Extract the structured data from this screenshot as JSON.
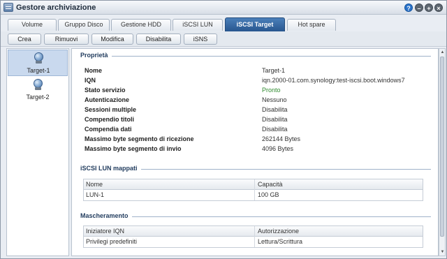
{
  "window": {
    "title": "Gestore archiviazione",
    "help_label": "?",
    "min_label": "–",
    "max_label": "+",
    "close_label": "×"
  },
  "tabs": [
    {
      "label": "Volume"
    },
    {
      "label": "Gruppo Disco"
    },
    {
      "label": "Gestione HDD"
    },
    {
      "label": "iSCSI LUN"
    },
    {
      "label": "iSCSI Target",
      "active": true
    },
    {
      "label": "Hot spare"
    }
  ],
  "toolbar": {
    "create": "Crea",
    "remove": "Rimuovi",
    "edit": "Modifica",
    "disable": "Disabilita",
    "isns": "iSNS"
  },
  "targets": [
    {
      "label": "Target-1",
      "selected": true
    },
    {
      "label": "Target-2"
    }
  ],
  "properties": {
    "title": "Proprietà",
    "rows": [
      {
        "label": "Nome",
        "value": "Target-1"
      },
      {
        "label": "IQN",
        "value": "iqn.2000-01.com.synology:test-iscsi.boot.windows7"
      },
      {
        "label": "Stato servizio",
        "value": "Pronto",
        "status": "ok"
      },
      {
        "label": "Autenticazione",
        "value": "Nessuno"
      },
      {
        "label": "Sessioni multiple",
        "value": "Disabilita"
      },
      {
        "label": "Compendio titoli",
        "value": "Disabilita"
      },
      {
        "label": "Compendia dati",
        "value": "Disabilita"
      },
      {
        "label": "Massimo byte segmento di ricezione",
        "value": "262144 Bytes"
      },
      {
        "label": "Massimo byte segmento di invio",
        "value": "4096 Bytes"
      }
    ]
  },
  "mapped_luns": {
    "title": "iSCSI LUN mappati",
    "columns": [
      "Nome",
      "Capacità"
    ],
    "rows": [
      [
        "LUN-1",
        "100 GB"
      ]
    ]
  },
  "masking": {
    "title": "Mascheramento",
    "columns": [
      "Iniziatore IQN",
      "Autorizzazione"
    ],
    "rows": [
      [
        "Privilegi predefiniti",
        "Lettura/Scrittura"
      ]
    ]
  },
  "scrollbar": {
    "up": "▲",
    "down": "▼"
  },
  "colors": {
    "accent": "#2a5d98",
    "status_ok": "#2f8a2f"
  }
}
